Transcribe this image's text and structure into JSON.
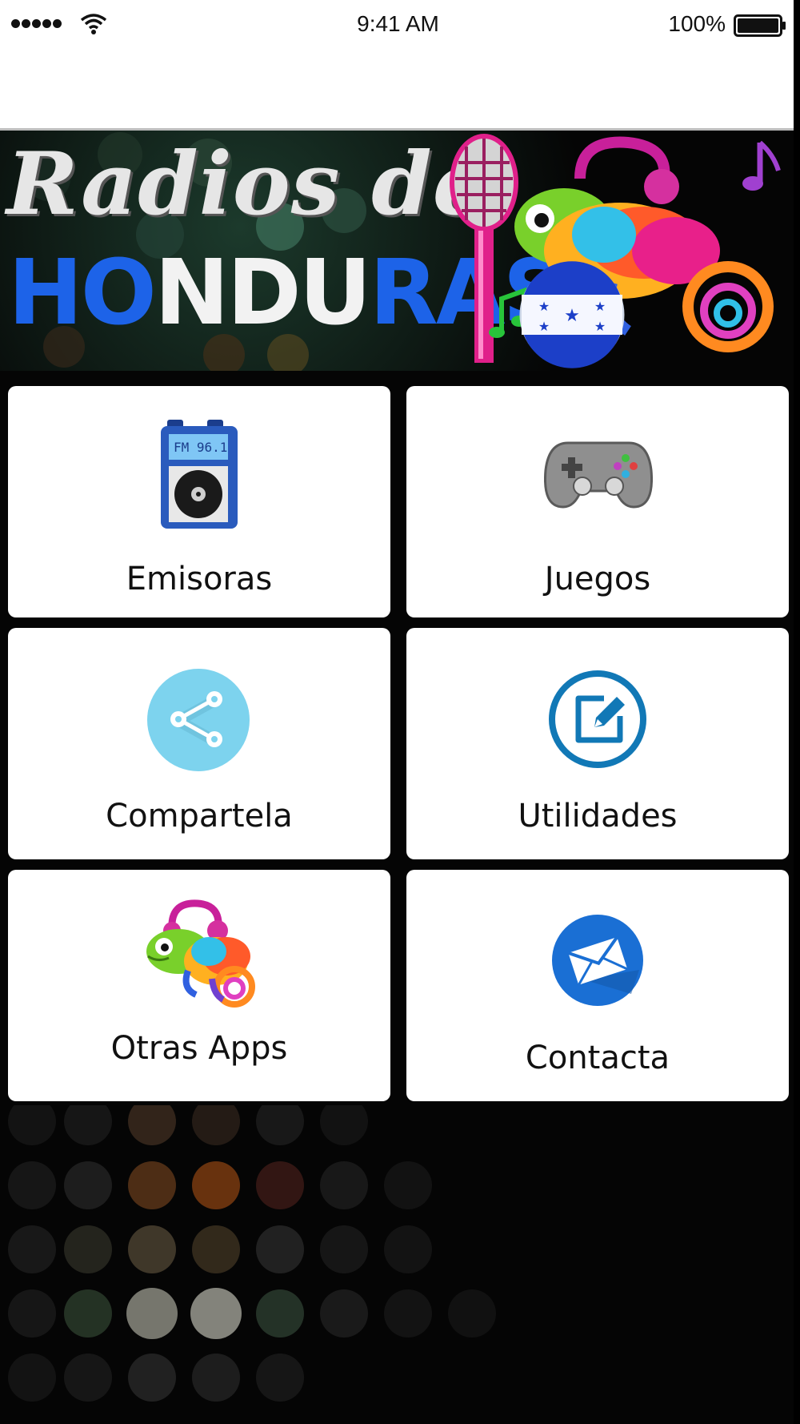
{
  "status_bar": {
    "time": "9:41 AM",
    "battery": "100%",
    "icons": [
      "signal-dots-icon",
      "wifi-icon",
      "battery-icon"
    ]
  },
  "banner": {
    "line1": "Radios de",
    "line2_parts": [
      "HO",
      "NDU",
      "RAS"
    ],
    "art": [
      "microphone-icon",
      "chameleon-icon",
      "honduras-flag-icon",
      "music-note-icon"
    ]
  },
  "menu": {
    "emisoras": {
      "label": "Emisoras",
      "icon": "radio-icon"
    },
    "juegos": {
      "label": "Juegos",
      "icon": "gamepad-icon"
    },
    "compartela": {
      "label": "Compartela",
      "icon": "share-icon"
    },
    "utilidades": {
      "label": "Utilidades",
      "icon": "edit-icon"
    },
    "otras_apps": {
      "label": "Otras Apps",
      "icon": "chameleon-icon"
    },
    "contacta": {
      "label": "Contacta",
      "icon": "mail-icon"
    }
  },
  "colors": {
    "accent_blue": "#1d63e8",
    "share_bg": "#7dd3ee",
    "edit_blue": "#1178b6",
    "mail_blue": "#1a6fd4"
  }
}
